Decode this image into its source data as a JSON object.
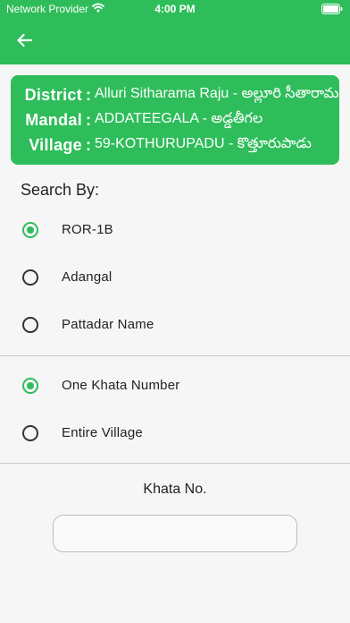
{
  "status_bar": {
    "carrier": "Network Provider",
    "time": "4:00 PM"
  },
  "colors": {
    "primary": "#2ebd5a",
    "background": "#f6f6f6"
  },
  "icons": {
    "back": "arrow-left-icon",
    "wifi": "wifi-icon",
    "battery": "battery-icon"
  },
  "location": {
    "district_label": "District",
    "district_value": "Alluri Sitharama Raju - అల్లూరి సీతారామ రాజు",
    "mandal_label": "Mandal",
    "mandal_value": "ADDATEEGALA - అడ్డతీగల",
    "village_label": "Village",
    "village_value": "59-KOTHURUPADU - కొత్తూరుపాడు",
    "separator": ":"
  },
  "search": {
    "title": "Search By:",
    "type_options": [
      "ROR-1B",
      "Adangal",
      "Pattadar Name"
    ],
    "type_selected": "ROR-1B",
    "scope_options": [
      "One Khata Number",
      "Entire Village"
    ],
    "scope_selected": "One Khata Number"
  },
  "khata": {
    "label": "Khata No.",
    "value": ""
  }
}
